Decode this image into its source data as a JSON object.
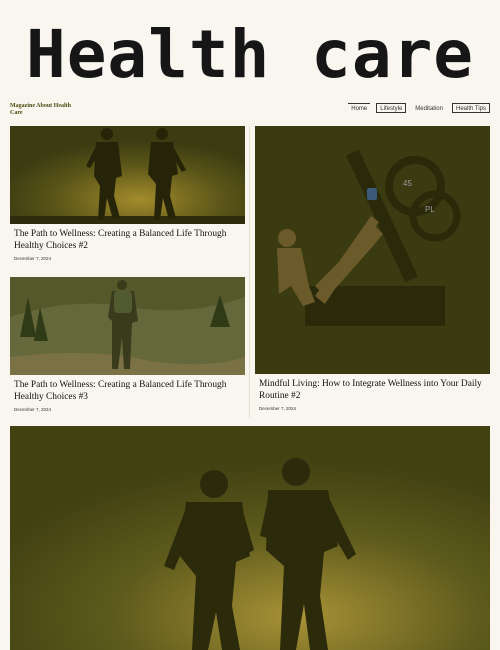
{
  "site": {
    "logo_text": "Health care",
    "tagline": "Magazine About Health Care"
  },
  "nav": {
    "items": [
      {
        "label": "Home"
      },
      {
        "label": "Lifestyle"
      },
      {
        "label": "Meditation"
      },
      {
        "label": "Health Tips"
      }
    ]
  },
  "posts": [
    {
      "title": "The Path to Wellness: Creating a Balanced Life Through Healthy Choices #2",
      "date": "December 7, 2024",
      "image": "runners-silhouette"
    },
    {
      "title": "Mindful Living: How to Integrate Wellness into Your Daily Routine #2",
      "date": "December 7, 2024",
      "image": "gym-leg-press"
    },
    {
      "title": "The Path to Wellness: Creating a Balanced Life Through Healthy Choices #3",
      "date": "December 7, 2024",
      "image": "hiker-meadow"
    },
    {
      "image": "runners-silhouette-large"
    }
  ],
  "colors": {
    "page_bg": "#f9f6ef",
    "image_tint": "#4b4a1a",
    "text": "#111111"
  }
}
